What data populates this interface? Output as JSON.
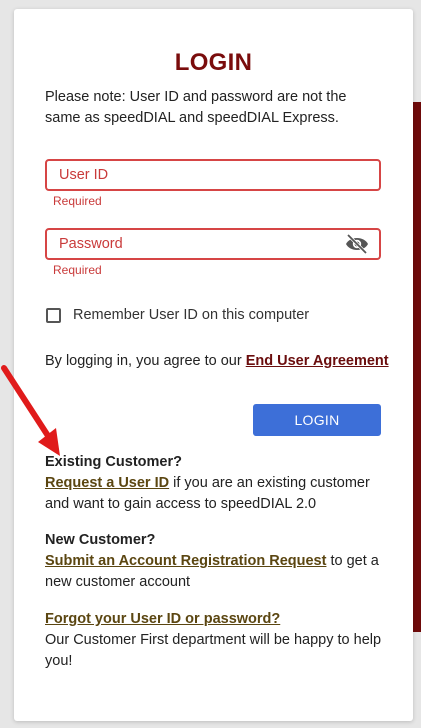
{
  "title": "LOGIN",
  "note": "Please note: User ID and password are not the same as speedDIAL and speedDIAL Express.",
  "userid": {
    "placeholder": "User ID",
    "value": "",
    "error": "Required"
  },
  "password": {
    "placeholder": "Password",
    "value": "",
    "error": "Required",
    "icon": "eye-off-icon"
  },
  "remember": {
    "label": "Remember User ID on this computer",
    "checked": false
  },
  "agreement": {
    "prefix": "By logging in, you agree to our ",
    "link": "End User Agreement"
  },
  "login_button": "LOGIN",
  "existing": {
    "heading": "Existing Customer?",
    "link": "Request a User ID",
    "text": " if you are an existing customer and want to gain access to speedDIAL 2.0"
  },
  "new": {
    "heading": "New Customer?",
    "link": "Submit an Account Registration Request",
    "text": " to get a new customer account"
  },
  "forgot": {
    "link": "Forgot your User ID or password?",
    "text": "Our Customer First department will be happy to help you!"
  },
  "colors": {
    "title": "#7a0c0c",
    "error": "#c93a3a",
    "button": "#3d6fd8",
    "link": "#5b4611",
    "agreement_link": "#6a0d0d",
    "side_bar": "#6e0a0a",
    "arrow": "#e01b1b"
  }
}
